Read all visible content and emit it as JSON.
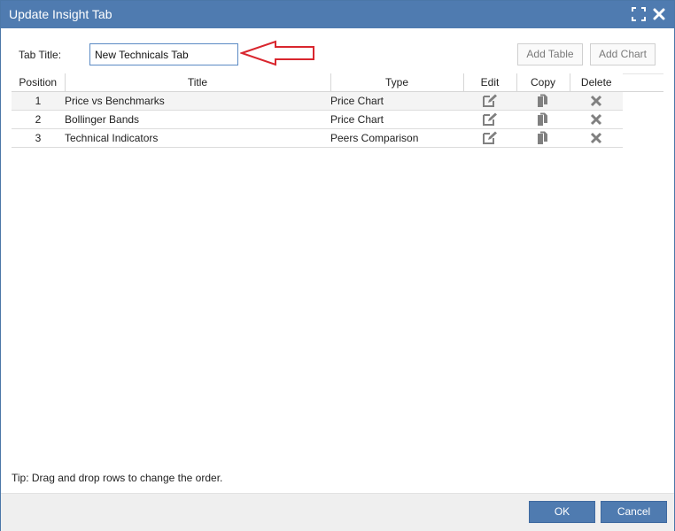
{
  "dialog": {
    "title": "Update Insight Tab",
    "icons": {
      "maximize": "fullscreen-icon",
      "close": "close-icon"
    }
  },
  "form": {
    "tab_title_label": "Tab Title:",
    "tab_title_value": "New Technicals Tab"
  },
  "toolbar": {
    "add_table_label": "Add Table",
    "add_chart_label": "Add Chart"
  },
  "table": {
    "headers": {
      "position": "Position",
      "title": "Title",
      "type": "Type",
      "edit": "Edit",
      "copy": "Copy",
      "delete": "Delete"
    },
    "rows": [
      {
        "position": "1",
        "title": "Price vs Benchmarks",
        "type": "Price Chart"
      },
      {
        "position": "2",
        "title": "Bollinger Bands",
        "type": "Price Chart"
      },
      {
        "position": "3",
        "title": "Technical Indicators",
        "type": "Peers Comparison"
      }
    ],
    "row_icons": {
      "edit": "edit-icon",
      "copy": "copy-icon",
      "delete": "delete-icon"
    }
  },
  "tip": "Tip: Drag and drop rows to change the order.",
  "footer": {
    "ok_label": "OK",
    "cancel_label": "Cancel"
  },
  "colors": {
    "titlebar": "#4f7bb0",
    "primary_button": "#4f7bb0",
    "annotation_arrow": "#d9262e"
  }
}
